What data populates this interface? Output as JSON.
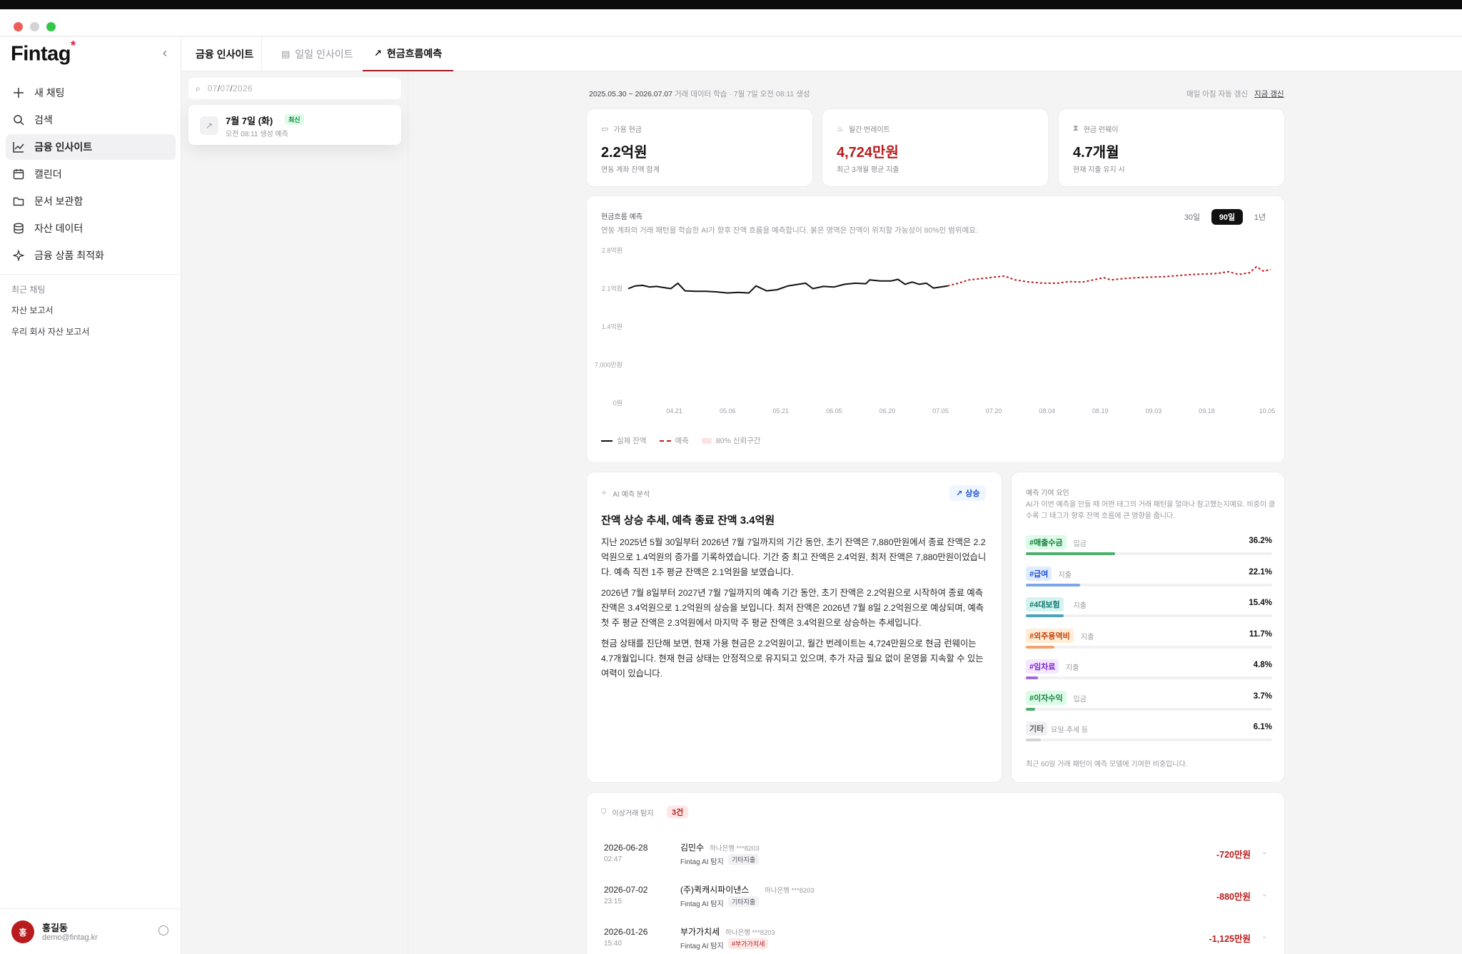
{
  "sidebar": {
    "logo": "Fintag",
    "logo_mark": "*",
    "nav": [
      {
        "label": "새 채팅",
        "icon": "plus-icon"
      },
      {
        "label": "검색",
        "icon": "search-icon"
      },
      {
        "label": "금융 인사이트",
        "icon": "chart-line-icon",
        "active": true
      },
      {
        "label": "캘린더",
        "icon": "calendar-icon"
      },
      {
        "label": "문서 보관함",
        "icon": "folder-icon"
      },
      {
        "label": "자산 데이터",
        "icon": "database-icon"
      },
      {
        "label": "금융 상품 최적화",
        "icon": "sparkle-icon"
      }
    ],
    "recent_title": "최근 채팅",
    "recent": [
      "자산 보고서",
      "우리 회사 자산 보고서"
    ],
    "user": {
      "avatar": "홍",
      "name": "홍길동",
      "email": "demo@fintag.kr"
    }
  },
  "tabs": {
    "section": "금융 인사이트",
    "daily": "일일 인사이트",
    "forecast": "현금흐름예측"
  },
  "list": {
    "search_date": {
      "month": "07",
      "day": "07",
      "year": "2026"
    },
    "entry": {
      "title": "7월 7일 (화)",
      "badge": "최신",
      "subtitle": "오전 08:11 생성 예측"
    }
  },
  "meta": {
    "period": "2025.05.30 ~ 2026.07.07",
    "period_note": "거래 데이터 학습 · 7월 7일 오전 08:11 생성",
    "auto": "매일 아침 자동 갱신",
    "refresh": "지금 갱신"
  },
  "kpis": [
    {
      "label": "가용 현금",
      "value": "2.2억원",
      "sub": "연동 계좌 잔액 합계",
      "icon": "wallet-icon"
    },
    {
      "label": "월간 번레이트",
      "value": "4,724만원",
      "sub": "최근 3개월 평균 지출",
      "icon": "flame-icon"
    },
    {
      "label": "현금 런웨이",
      "value": "4.7개월",
      "sub": "현재 지출 유지 시",
      "icon": "hourglass-icon"
    }
  ],
  "forecast_chart": {
    "title": "현금흐름 예측",
    "desc": "연동 계좌의 거래 패턴을 학습한 AI가 향후 잔액 흐름을 예측합니다. 붉은 영역은 잔액이 위치할 가능성이 80%인 범위예요.",
    "ranges": [
      "30일",
      "90일",
      "1년"
    ],
    "selected_range": "90일",
    "legend": {
      "actual": "실제 잔액",
      "forecast": "예측",
      "band": "80% 신뢰구간"
    },
    "colors": {
      "actual": "#111111",
      "forecast": "#b91c1c",
      "band": "#fde2e2"
    }
  },
  "chart_data": {
    "type": "line",
    "title": "현금흐름 예측",
    "xlabel": "",
    "ylabel": "",
    "ylim": [
      0,
      2.8
    ],
    "y_ticks": [
      0,
      0.7,
      1.4,
      2.1,
      2.8
    ],
    "y_tick_labels": [
      "0원",
      "7,000만원",
      "1.4억원",
      "2.1억원",
      "2.8억원"
    ],
    "x_tick_labels": [
      "04.21",
      "05.06",
      "05.21",
      "06.05",
      "06.20",
      "07.05",
      "07.20",
      "08.04",
      "08.19",
      "09.03",
      "09.18",
      "10.05"
    ],
    "grid": false,
    "legend_position": "bottom-left",
    "series": [
      {
        "name": "실제 잔액",
        "style": "solid",
        "points": [
          [
            "04.08",
            2.1
          ],
          [
            "04.10",
            2.15
          ],
          [
            "04.12",
            2.16
          ],
          [
            "04.14",
            2.13
          ],
          [
            "04.16",
            2.14
          ],
          [
            "04.18",
            2.12
          ],
          [
            "04.20",
            2.1
          ],
          [
            "04.22",
            2.2
          ],
          [
            "04.24",
            2.06
          ],
          [
            "04.27",
            2.05
          ],
          [
            "04.30",
            2.05
          ],
          [
            "05.03",
            2.04
          ],
          [
            "05.06",
            2.02
          ],
          [
            "05.09",
            2.03
          ],
          [
            "05.12",
            2.02
          ],
          [
            "05.14",
            2.15
          ],
          [
            "05.17",
            2.06
          ],
          [
            "05.20",
            2.08
          ],
          [
            "05.23",
            2.15
          ],
          [
            "05.26",
            2.18
          ],
          [
            "05.28",
            2.2
          ],
          [
            "05.30",
            2.1
          ],
          [
            "06.02",
            2.14
          ],
          [
            "06.05",
            2.13
          ],
          [
            "06.08",
            2.18
          ],
          [
            "06.11",
            2.2
          ],
          [
            "06.14",
            2.19
          ],
          [
            "06.15",
            2.26
          ],
          [
            "06.18",
            2.24
          ],
          [
            "06.21",
            2.24
          ],
          [
            "06.23",
            2.27
          ],
          [
            "06.25",
            2.18
          ],
          [
            "06.27",
            2.22
          ],
          [
            "06.29",
            2.18
          ],
          [
            "07.01",
            2.2
          ],
          [
            "07.03",
            2.11
          ],
          [
            "07.05",
            2.13
          ],
          [
            "07.07",
            2.15
          ]
        ]
      },
      {
        "name": "예측",
        "style": "dashed",
        "points": [
          [
            "07.07",
            2.15
          ],
          [
            "07.10",
            2.2
          ],
          [
            "07.13",
            2.26
          ],
          [
            "07.16",
            2.28
          ],
          [
            "07.20",
            2.31
          ],
          [
            "07.23",
            2.33
          ],
          [
            "07.26",
            2.26
          ],
          [
            "07.30",
            2.22
          ],
          [
            "08.03",
            2.2
          ],
          [
            "08.07",
            2.2
          ],
          [
            "08.10",
            2.23
          ],
          [
            "08.14",
            2.22
          ],
          [
            "08.17",
            2.26
          ],
          [
            "08.20",
            2.3
          ],
          [
            "08.22",
            2.26
          ],
          [
            "08.25",
            2.28
          ],
          [
            "08.29",
            2.3
          ],
          [
            "09.02",
            2.31
          ],
          [
            "09.06",
            2.32
          ],
          [
            "09.10",
            2.34
          ],
          [
            "09.14",
            2.36
          ],
          [
            "09.18",
            2.37
          ],
          [
            "09.21",
            2.38
          ],
          [
            "09.24",
            2.41
          ],
          [
            "09.27",
            2.36
          ],
          [
            "09.30",
            2.39
          ],
          [
            "10.02",
            2.5
          ],
          [
            "10.04",
            2.42
          ],
          [
            "10.06",
            2.45
          ]
        ]
      }
    ]
  },
  "ai_analysis": {
    "label": "AI 예측 분석",
    "trend": "상승",
    "headline": "잔액 상승 추세, 예측 종료 잔액 3.4억원",
    "paragraphs": [
      "지난 2025년 5월 30일부터 2026년 7월 7일까지의 기간 동안, 초기 잔액은 7,880만원에서 종료 잔액은 2.2억원으로 1.4억원의 증가를 기록하였습니다. 기간 중 최고 잔액은 2.4억원, 최저 잔액은 7,880만원이었습니다. 예측 직전 1주 평균 잔액은 2.1억원을 보였습니다.",
      "2026년 7월 8일부터 2027년 7월 7일까지의 예측 기간 동안, 초기 잔액은 2.2억원으로 시작하여 종료 예측 잔액은 3.4억원으로 1.2억원의 상승을 보입니다. 최저 잔액은 2026년 7월 8일 2.2억원으로 예상되며, 예측 첫 주 평균 잔액은 2.3억원에서 마지막 주 평균 잔액은 3.4억원으로 상승하는 추세입니다.",
      "현금 상태를 진단해 보면, 현재 가용 현금은 2.2억원이고, 월간 번레이트는 4,724만원으로 현금 런웨이는 4.7개월입니다. 현재 현금 상태는 안정적으로 유지되고 있으며, 추가 자금 필요 없이 운영을 지속할 수 있는 여력이 있습니다."
    ]
  },
  "factors": {
    "title": "예측 기여 요인",
    "desc": "AI가 이번 예측을 만들 때 어떤 태그의 거래 패턴을 얼마나 참고했는지예요. 비중이 클수록 그 태그가 향후 잔액 흐름에 큰 영향을 줍니다.",
    "items": [
      {
        "tag": "#매출수금",
        "kind": "입금",
        "pct": "36.2%",
        "value": 36.2,
        "color": "#15803d",
        "bg": "#dcfce7",
        "bar": "#4caf6a"
      },
      {
        "tag": "#급여",
        "kind": "지출",
        "pct": "22.1%",
        "value": 22.1,
        "color": "#1d4ed8",
        "bg": "#e0ecff",
        "bar": "#7da6e8"
      },
      {
        "tag": "#4대보험",
        "kind": "지출",
        "pct": "15.4%",
        "value": 15.4,
        "color": "#0f766e",
        "bg": "#d5f3ef",
        "bar": "#4aa3b8"
      },
      {
        "tag": "#외주용역비",
        "kind": "지출",
        "pct": "11.7%",
        "value": 11.7,
        "color": "#c2410c",
        "bg": "#ffedd5",
        "bar": "#f2a36b"
      },
      {
        "tag": "#임차료",
        "kind": "지출",
        "pct": "4.8%",
        "value": 4.8,
        "color": "#7e22ce",
        "bg": "#f3e8ff",
        "bar": "#9b6be0"
      },
      {
        "tag": "#이자수익",
        "kind": "입금",
        "pct": "3.7%",
        "value": 3.7,
        "color": "#15803d",
        "bg": "#dcfce7",
        "bar": "#4caf6a"
      },
      {
        "tag": "기타",
        "kind": "요일·추세 등",
        "pct": "6.1%",
        "value": 6.1,
        "color": "#52525b",
        "bg": "#f1f1f3",
        "bar": "#d4d4d8"
      }
    ],
    "footnote": "최근 60일 거래 패턴이 예측 모델에 기여한 비중입니다."
  },
  "anomalies": {
    "title": "이상거래 탐지",
    "count": "3건",
    "rows": [
      {
        "date": "2026-06-28",
        "time": "02:47",
        "name": "김민수",
        "bank": "하나은행 ***8203",
        "source": "Fintag AI 탐지",
        "tag": "기타지출",
        "tag_red": false,
        "amount": "-720만원"
      },
      {
        "date": "2026-07-02",
        "time": "23:15",
        "name": "(주)퀵캐시파이낸스",
        "bank": "하나은행 ***8203",
        "source": "Fintag AI 탐지",
        "tag": "기타지출",
        "tag_red": false,
        "amount": "-880만원"
      },
      {
        "date": "2026-01-26",
        "time": "15:40",
        "name": "부가가치세",
        "bank": "하나은행 ***8203",
        "source": "Fintag AI 탐지",
        "tag": "#부가가치세",
        "tag_red": true,
        "amount": "-1,125만원"
      }
    ]
  }
}
